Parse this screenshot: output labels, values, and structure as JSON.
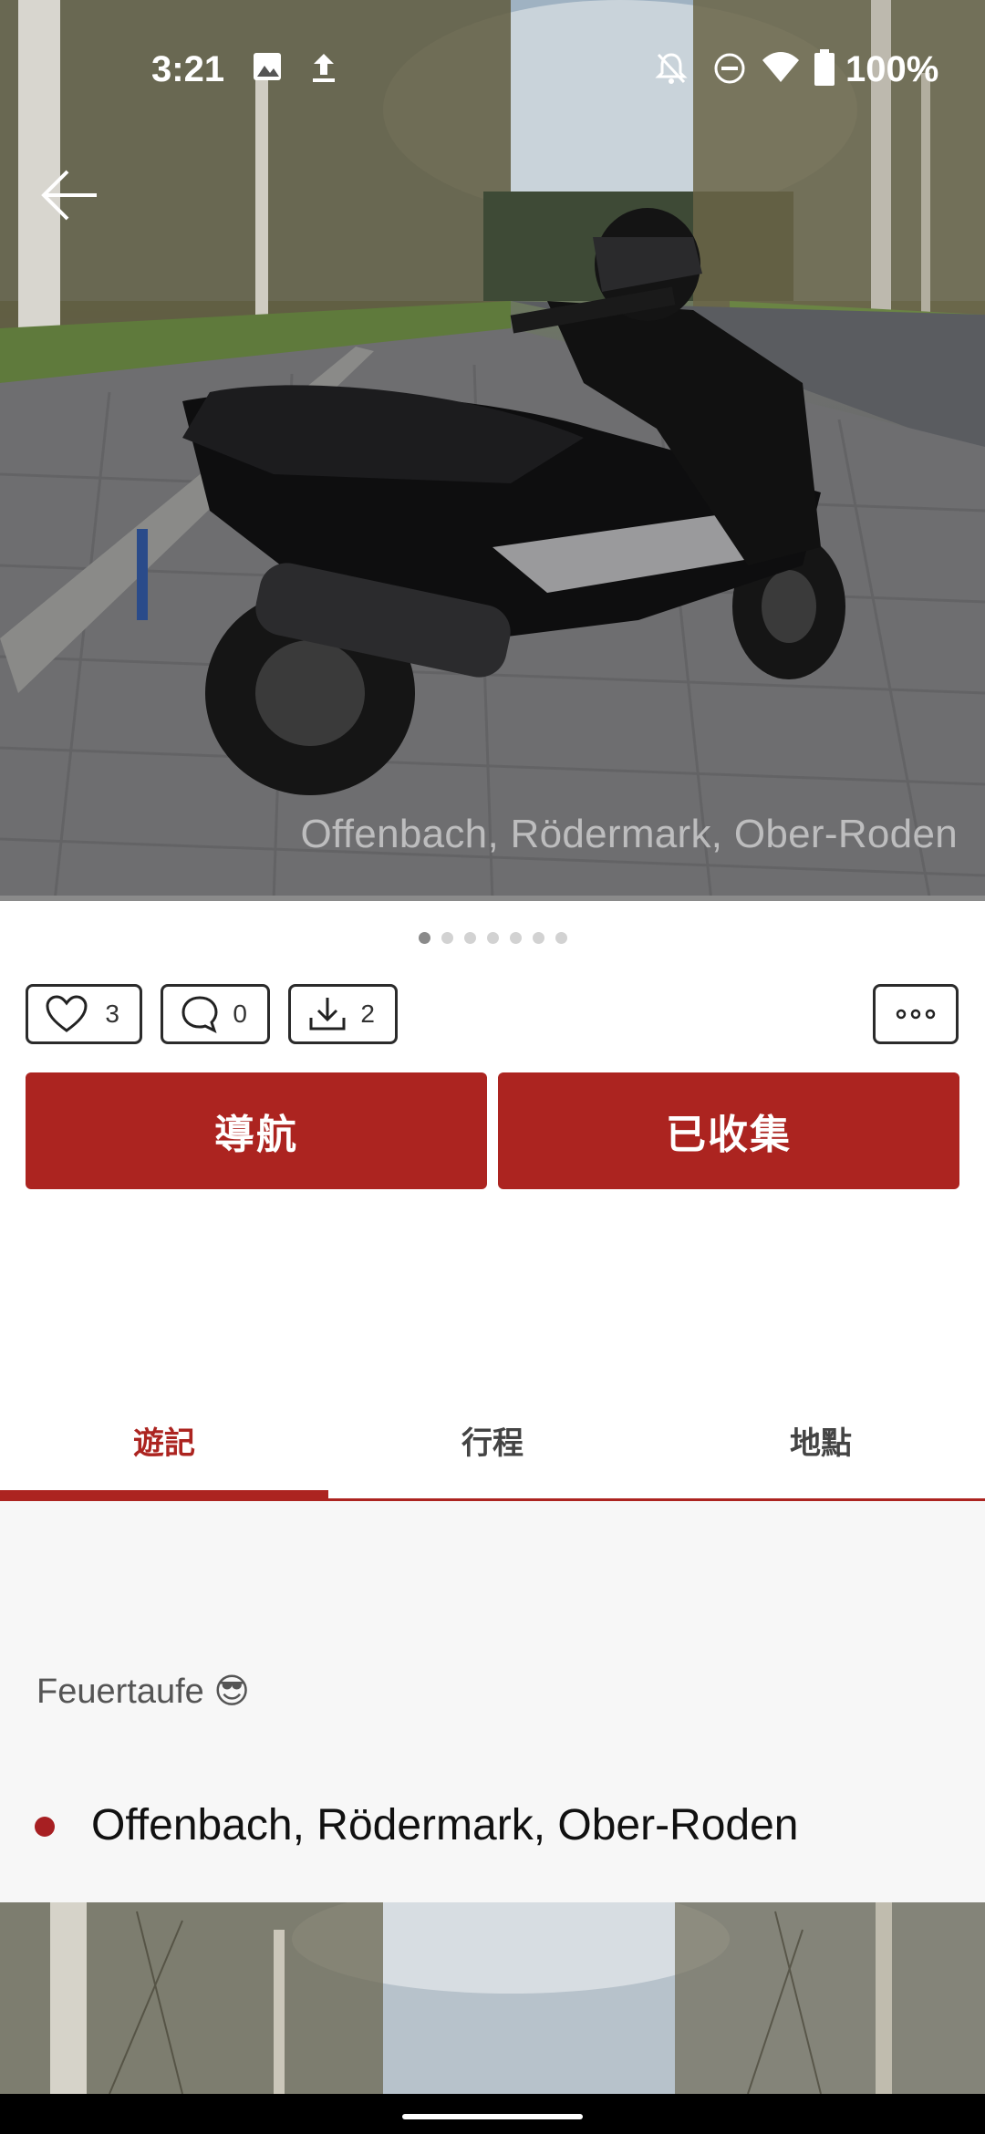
{
  "status_bar": {
    "time": "3:21",
    "battery_percent": "100%",
    "icons": [
      "image-icon",
      "upload-icon",
      "bell-off-icon",
      "do-not-disturb-icon",
      "wifi-icon",
      "battery-icon"
    ]
  },
  "hero": {
    "caption": "Offenbach, Rödermark, Ober-Roden",
    "total_photos": 7,
    "active_photo_index": 0
  },
  "actions": {
    "like_count": "3",
    "comment_count": "0",
    "download_count": "2",
    "navigate_label": "導航",
    "collected_label": "已收集"
  },
  "tabs": [
    {
      "label": "遊記",
      "active": true
    },
    {
      "label": "行程",
      "active": false
    },
    {
      "label": "地點",
      "active": false
    }
  ],
  "story": {
    "title": "Feuertaufe 😎",
    "location_name": "Offenbach, Rödermark, Ober-Roden"
  },
  "colors": {
    "accent": "#ac2420",
    "location_dot": "#a71f22",
    "content_bg": "#f7f7f7"
  }
}
